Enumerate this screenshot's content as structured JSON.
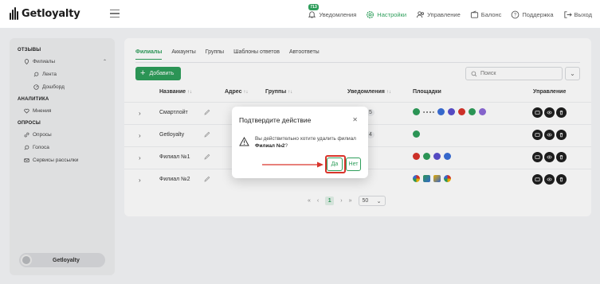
{
  "app": {
    "logo_text": "Getloyalty",
    "notifications_badge": "713"
  },
  "topnav": [
    {
      "label": "Уведомления",
      "icon": "bell-icon"
    },
    {
      "label": "Настройки",
      "icon": "gear-icon",
      "active": true
    },
    {
      "label": "Управление",
      "icon": "users-icon"
    },
    {
      "label": "Балонс",
      "icon": "wallet-icon"
    },
    {
      "label": "Поддержка",
      "icon": "help-icon"
    },
    {
      "label": "Выход",
      "icon": "logout-icon"
    }
  ],
  "sidebar": {
    "sections": [
      {
        "title": "ОТЗЫВЫ",
        "items": [
          {
            "label": "Филиалы",
            "icon": "location-icon",
            "expanded": true
          },
          {
            "label": "Лента",
            "icon": "search-icon",
            "sub": true
          },
          {
            "label": "Дошборд",
            "icon": "dashboard-icon",
            "sub": true
          }
        ]
      },
      {
        "title": "АНАЛИТИКА",
        "items": [
          {
            "label": "Мнения",
            "icon": "heart-icon"
          }
        ]
      },
      {
        "title": "ОПРОСЫ",
        "items": [
          {
            "label": "Опросы",
            "icon": "link-icon"
          },
          {
            "label": "Голоса",
            "icon": "search-icon"
          },
          {
            "label": "Сервисы рассылки",
            "icon": "mail-icon"
          }
        ]
      }
    ],
    "profile_name": "Getloyalty"
  },
  "main": {
    "tabs": [
      "Филиалы",
      "Аккаунты",
      "Группы",
      "Шаблоны ответов",
      "Автоответы"
    ],
    "add_label": "Добавить",
    "search_placeholder": "Поиск",
    "headers": {
      "name": "Название",
      "address": "Адрес",
      "groups": "Группы",
      "notifications": "Уведомления",
      "platforms": "Площадки",
      "management": "Управление"
    },
    "sort_symbol": "↑↓",
    "rows": [
      {
        "name": "Смартлойт",
        "notifications": "5",
        "platforms": [
          "green",
          "dots",
          "blue",
          "purple",
          "red",
          "green",
          "purple"
        ]
      },
      {
        "name": "Getloyalty",
        "notifications": "4",
        "platforms": [
          "green"
        ]
      },
      {
        "name": "Филиал №1",
        "notifications": "",
        "platforms": [
          "red",
          "green",
          "purple",
          "blue"
        ]
      },
      {
        "name": "Филиал №2",
        "notifications": "",
        "platforms": [
          "g",
          "multi",
          "multi",
          "g"
        ]
      }
    ],
    "pager": {
      "current": "1",
      "page_size": "50"
    }
  },
  "modal": {
    "title": "Подтвердите действие",
    "message_prefix": "Вы действительно хотите удалить филиал",
    "message_target": "Филиал №2",
    "message_suffix": "?",
    "yes_label": "Да",
    "no_label": "Нет"
  },
  "colors": {
    "accent": "#2e9e5b",
    "highlight": "#d9342b"
  }
}
